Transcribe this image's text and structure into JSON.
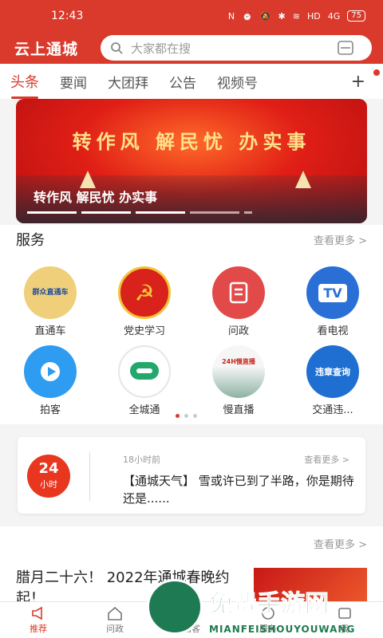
{
  "status_bar": {
    "time": "12:43",
    "icons": [
      "nfc-icon",
      "alarm-icon",
      "mute-icon",
      "bluetooth-icon",
      "wifi-icon",
      "hd-icon",
      "signal-icon"
    ],
    "signal_text": "4G",
    "hd_text": "HD",
    "battery": "75"
  },
  "header": {
    "app_title": "云上通城",
    "search_placeholder": "大家都在搜"
  },
  "tabs": {
    "items": [
      "头条",
      "要闻",
      "大团拜",
      "公告",
      "视频号"
    ],
    "active": 0,
    "add_label": "+"
  },
  "banner": {
    "headline": "转作风 解民忧 办实事",
    "caption": "转作风 解民忧 办实事",
    "page_count": 5,
    "current": 3
  },
  "services": {
    "title": "服务",
    "more": "查看更多 >",
    "items": [
      {
        "label": "直通车",
        "icon": "car-badge-icon",
        "badge": "群众直通车"
      },
      {
        "label": "党史学习",
        "icon": "party-emblem-icon"
      },
      {
        "label": "问政",
        "icon": "document-icon"
      },
      {
        "label": "看电视",
        "icon": "tv-icon",
        "badge": "TV"
      },
      {
        "label": "拍客",
        "icon": "play-icon"
      },
      {
        "label": "全城通",
        "icon": "chat-bubble-icon"
      },
      {
        "label": "慢直播",
        "icon": "city-view-icon",
        "badge": "24H慢直播"
      },
      {
        "label": "交通违...",
        "icon": "traffic-violation-icon",
        "badge": "违章查询"
      }
    ],
    "pager": [
      true,
      false,
      false
    ]
  },
  "weather_card": {
    "logo_number": "24",
    "logo_unit": "小时",
    "time": "18小时前",
    "more": "查看更多 >",
    "text": "【通城天气】 雪或许已到了半路，你是期待还是......"
  },
  "news": {
    "more": "查看更多 >",
    "title": "腊月二十六！ 2022年通城春晚约起！"
  },
  "bottom_nav": [
    {
      "label": "推荐",
      "icon": "megaphone-icon",
      "active": true
    },
    {
      "label": "问政",
      "icon": "home-icon",
      "active": false
    },
    {
      "label": "拍客",
      "icon": "camera-icon",
      "active": false
    },
    {
      "label": "服务",
      "icon": "service-icon",
      "active": false
    },
    {
      "label": "我",
      "icon": "user-icon",
      "active": false
    }
  ],
  "watermark": {
    "text": "免费手游网",
    "sub": "MIANFEISHOUYOUWANG"
  },
  "colors": {
    "brand_red": "#d93a2b",
    "watermark_green": "#1d7a52"
  }
}
